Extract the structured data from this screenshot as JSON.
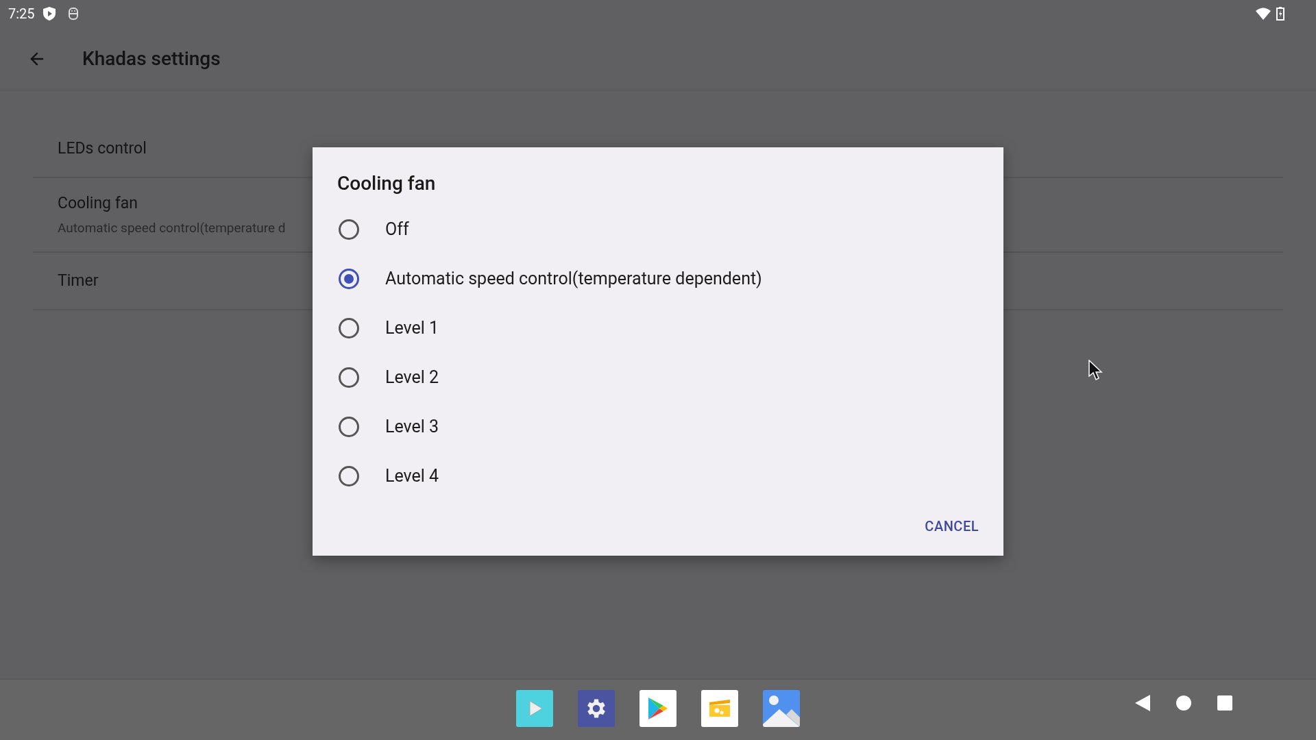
{
  "status_bar": {
    "time": "7:25"
  },
  "app_bar": {
    "title": "Khadas settings"
  },
  "settings": [
    {
      "title": "LEDs control"
    },
    {
      "title": "Cooling fan",
      "summary": "Automatic speed control(temperature d"
    },
    {
      "title": "Timer"
    }
  ],
  "dialog": {
    "title": "Cooling fan",
    "options": [
      {
        "label": "Off",
        "selected": false
      },
      {
        "label": "Automatic speed control(temperature dependent)",
        "selected": true
      },
      {
        "label": "Level 1",
        "selected": false
      },
      {
        "label": "Level 2",
        "selected": false
      },
      {
        "label": "Level 3",
        "selected": false
      },
      {
        "label": "Level 4",
        "selected": false
      }
    ],
    "buttons": [
      "CANCEL"
    ]
  },
  "dock": [
    {
      "kind": "video"
    },
    {
      "kind": "settings"
    },
    {
      "kind": "store"
    },
    {
      "kind": "files"
    },
    {
      "kind": "gallery"
    }
  ]
}
